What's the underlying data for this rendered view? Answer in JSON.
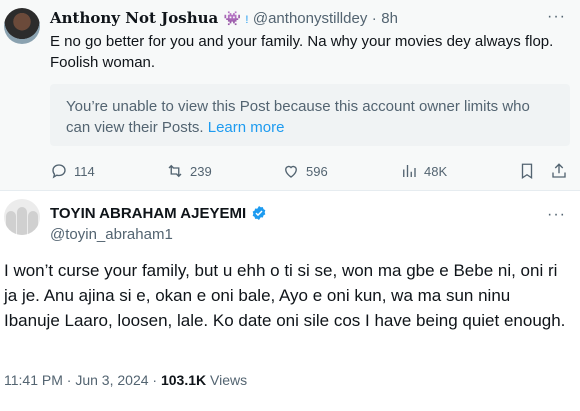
{
  "tweet1": {
    "display_name_pre": "Anthony",
    "display_name_not": "Not",
    "display_name_post": "Joshua",
    "handle": "@anthonystilldey",
    "time": "8h",
    "text": "E no go better for you and your family. Na why your movies dey always flop. Foolish woman.",
    "restricted_text": "You’re unable to view this Post because this account owner limits who can view their Posts.",
    "learn_more": "Learn more",
    "replies": "114",
    "reposts": "239",
    "likes": "596",
    "views": "48K"
  },
  "tweet2": {
    "display_name": "TOYIN ABRAHAM AJEYEMI",
    "handle": "@toyin_abraham1",
    "text": "I won’t curse your family, but u ehh o ti si se, won ma gbe e Bebe ni, oni ri ja je. Anu ajina si e, okan e oni bale, Ayo e oni kun, wa ma sun ninu Ibanuje Laaro, loosen, lale. Ko date oni sile cos I have being quiet enough.",
    "time": "11:41 PM",
    "date": "Jun 3, 2024",
    "views_count": "103.1K",
    "views_label": "Views"
  },
  "colors": {
    "accent": "#1d9bf0",
    "muted": "#536471",
    "text": "#0f1419",
    "verified_badge": "#1d9bf0",
    "purple_emoji": "#8e44ad"
  }
}
